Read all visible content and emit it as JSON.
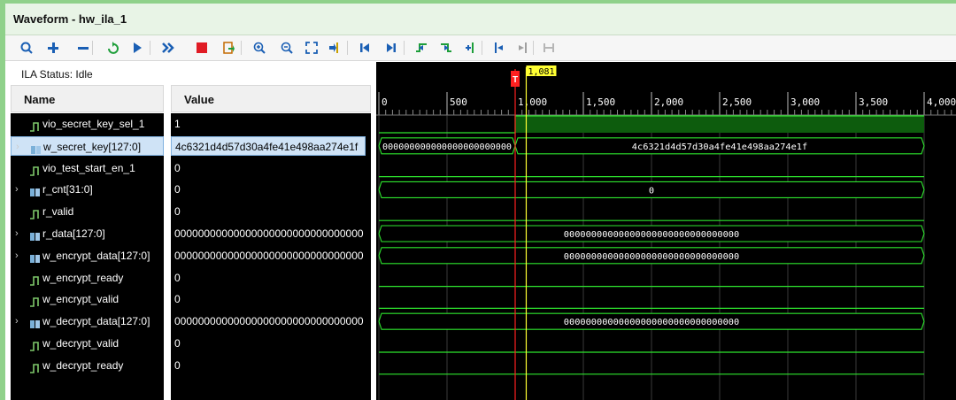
{
  "window": {
    "title": "Waveform - hw_ila_1"
  },
  "toolbar": {
    "icons": [
      "search-icon",
      "zoom-add-icon",
      "minus-icon",
      "refresh-icon",
      "run-icon",
      "run-immediate-icon",
      "stop-icon",
      "export-icon",
      "zoom-in-icon",
      "zoom-out-icon",
      "zoom-fit-icon",
      "go-to-cursor-icon",
      "go-to-start-icon",
      "go-to-end-icon",
      "previous-transition-icon",
      "next-transition-icon",
      "add-marker-icon",
      "previous-marker-icon",
      "next-marker-icon",
      "swap-cursor-icon"
    ]
  },
  "ila": {
    "status": "ILA Status: Idle"
  },
  "columns": {
    "name": "Name",
    "value": "Value"
  },
  "signals": [
    {
      "name": "vio_secret_key_sel_1",
      "value": "1",
      "bus": false,
      "selected": false
    },
    {
      "name": "w_secret_key[127:0]",
      "value": "4c6321d4d57d30a4fe41e498aa274e1f",
      "bus": true,
      "selected": true
    },
    {
      "name": "vio_test_start_en_1",
      "value": "0",
      "bus": false,
      "selected": false
    },
    {
      "name": "r_cnt[31:0]",
      "value": "0",
      "bus": true,
      "selected": false
    },
    {
      "name": "r_valid",
      "value": "0",
      "bus": false,
      "selected": false
    },
    {
      "name": "r_data[127:0]",
      "value": "00000000000000000000000000000000",
      "bus": true,
      "selected": false
    },
    {
      "name": "w_encrypt_data[127:0]",
      "value": "00000000000000000000000000000000",
      "bus": true,
      "selected": false
    },
    {
      "name": "w_encrypt_ready",
      "value": "0",
      "bus": false,
      "selected": false
    },
    {
      "name": "w_encrypt_valid",
      "value": "0",
      "bus": false,
      "selected": false
    },
    {
      "name": "w_decrypt_data[127:0]",
      "value": "00000000000000000000000000000000",
      "bus": true,
      "selected": false
    },
    {
      "name": "w_decrypt_valid",
      "value": "0",
      "bus": false,
      "selected": false
    },
    {
      "name": "w_decrypt_ready",
      "value": "0",
      "bus": false,
      "selected": false
    }
  ],
  "waveform": {
    "ruler_min": 0,
    "ruler_max": 4000,
    "ruler_ticks": [
      "0",
      "500",
      "1,000",
      "1,500",
      "2,000",
      "2,500",
      "3,000",
      "3,500",
      "4,000"
    ],
    "trigger_label": "T",
    "trigger_sample": 1000,
    "cursor_label": "1,081",
    "cursor_sample": 1081,
    "buses": [
      {
        "row": 1,
        "segments": [
          {
            "from": 0,
            "to": 1000,
            "label": "000000000000000000000000"
          },
          {
            "from": 1000,
            "to": 4000,
            "label": "4c6321d4d57d30a4fe41e498aa274e1f"
          }
        ]
      },
      {
        "row": 3,
        "segments": [
          {
            "from": 0,
            "to": 4000,
            "label": "0"
          }
        ]
      },
      {
        "row": 5,
        "segments": [
          {
            "from": 0,
            "to": 4000,
            "label": "00000000000000000000000000000000"
          }
        ]
      },
      {
        "row": 6,
        "segments": [
          {
            "from": 0,
            "to": 4000,
            "label": "00000000000000000000000000000000"
          }
        ]
      },
      {
        "row": 9,
        "segments": [
          {
            "from": 0,
            "to": 4000,
            "label": "00000000000000000000000000000000"
          }
        ]
      }
    ],
    "bits": [
      {
        "row": 0,
        "level": 1,
        "rise_at": 1000
      },
      {
        "row": 2,
        "level": 0
      },
      {
        "row": 4,
        "level": 0
      },
      {
        "row": 7,
        "level": 0
      },
      {
        "row": 8,
        "level": 0
      },
      {
        "row": 10,
        "level": 0
      },
      {
        "row": 11,
        "level": 0
      }
    ],
    "colors": {
      "wave": "#2ee62e",
      "high_fill": "#0d5c0d",
      "trigger": "#ff2020",
      "cursor": "#ffff33",
      "grid": "#3a3a3a",
      "text": "#ffffff"
    }
  }
}
